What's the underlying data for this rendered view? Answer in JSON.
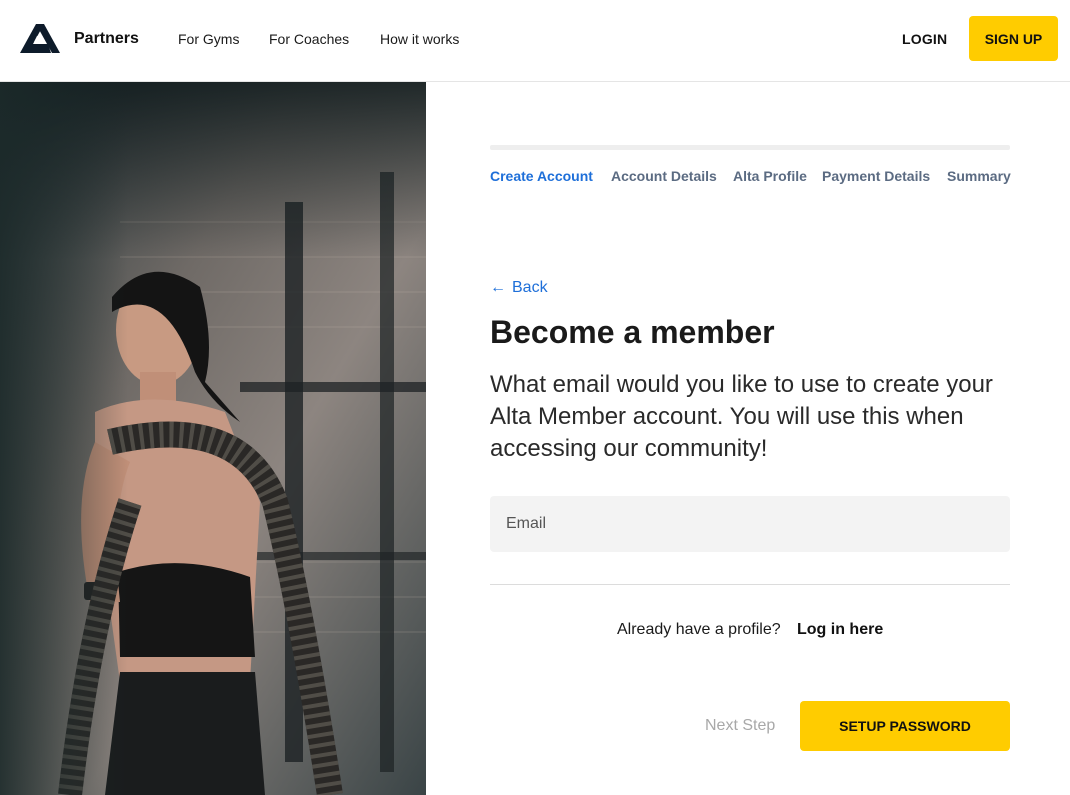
{
  "header": {
    "brand": "Partners",
    "nav": [
      "For Gyms",
      "For Coaches",
      "How it works"
    ],
    "login_label": "LOGIN",
    "signup_label": "SIGN UP"
  },
  "steps": {
    "items": [
      "Create Account",
      "Account Details",
      "Alta Profile",
      "Payment Details",
      "Summary"
    ],
    "active_index": 0
  },
  "form": {
    "back_label": "Back",
    "title": "Become a member",
    "description": "What email would you like to use to create your Alta Member account. You will use this when accessing our community!",
    "email_placeholder": "Email",
    "email_value": "",
    "already_text": "Already have a profile?",
    "login_link": "Log in here",
    "next_step_label": "Next Step",
    "submit_label": "SETUP PASSWORD"
  },
  "colors": {
    "accent": "#ffcc00",
    "link": "#1e6fd9",
    "step_inactive": "#5b6b82"
  }
}
